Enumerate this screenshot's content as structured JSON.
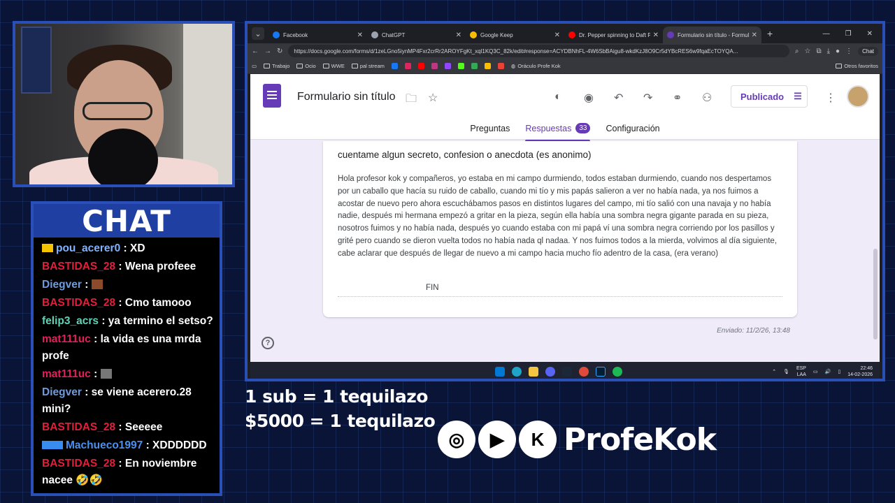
{
  "browser": {
    "tabs": [
      {
        "title": "Facebook",
        "color": "#1877f2"
      },
      {
        "title": "ChatGPT",
        "color": "#9ca3af"
      },
      {
        "title": "Google Keep",
        "color": "#fbbc04"
      },
      {
        "title": "Dr. Pepper spinning to Daft Punk",
        "color": "#ff0000"
      },
      {
        "title": "Formulario sin título - Formulario",
        "color": "#673ab7"
      }
    ],
    "url": "https://docs.google.com/forms/d/1zeLGno5iynMP4Fxr2crRr2AROYFgKt_xql1KQ3C_82k/edit#response=ACYDBNhFL-4W6SbBAigu8-wkdKzJ8O9Cr5dYBcRES6w9fqaEcTOYQA...",
    "chat_label": "Chat",
    "bookmarks": [
      "Trabajo",
      "Ocio",
      "WWE",
      "pal stream"
    ],
    "bookmark_profile": "Oráculo Profe Kok",
    "other_bookmarks": "Otros favoritos"
  },
  "form": {
    "title": "Formulario sin título",
    "publish_label": "Publicado",
    "tabs": [
      "Preguntas",
      "Respuestas",
      "Configuración"
    ],
    "responses_count": "33",
    "question": "cuentame algun secreto, confesion o anecdota (es anonimo)",
    "answer": "Hola profesor kok y compañeros, yo estaba en mi campo durmiendo, todos estaban durmiendo, cuando nos despertamos por un caballo que hacía su ruido de caballo, cuando mi tío y mis papás salieron a ver no había nada, ya nos fuimos a acostar de nuevo pero ahora escuchábamos pasos en distintos lugares del campo, mi tío salió con una navaja y no había nadie, después mi hermana empezó a gritar en la pieza, según ella había una sombra negra gigante parada en su pieza, nosotros fuimos y no había nada, después yo cuando estaba con mi papá ví una sombra negra corriendo por los pasillos y grité pero cuando se dieron vuelta todos no había nada ql nadaa. Y nos fuimos todos a la mierda, volvimos al día siguiente, cabe aclarar que después de llegar de nuevo a mi campo hacia mucho fío adentro de la casa, (era verano)",
    "fin": "FIN",
    "sent": "Enviado: 11/2/26, 13:48"
  },
  "taskbar": {
    "lang": "ESP",
    "region": "LAA",
    "time": "22:46",
    "date": "14-02-2026"
  },
  "chat": {
    "header": "CHAT",
    "messages": [
      {
        "user": "pou_acerer0",
        "color": "#7fb3ff",
        "text": ": XD"
      },
      {
        "user": "BASTIDAS_28",
        "color": "#e0203a",
        "text": ": Wena profeee"
      },
      {
        "user": "Diegver",
        "color": "#6f9bdc",
        "text": ":"
      },
      {
        "user": "BASTIDAS_28",
        "color": "#e0203a",
        "text": ": Cmo tamooo"
      },
      {
        "user": "felip3_acrs",
        "color": "#5fd3b6",
        "text": ": ya termino el setso?"
      },
      {
        "user": "mat111uc",
        "color": "#e0205a",
        "text": ": la vida es una mrda profe"
      },
      {
        "user": "mat111uc",
        "color": "#e0205a",
        "text": ":"
      },
      {
        "user": "Diegver",
        "color": "#6f9bdc",
        "text": ": se viene acerero.28 mini?"
      },
      {
        "user": "BASTIDAS_28",
        "color": "#e0203a",
        "text": ": Seeeee"
      },
      {
        "user": "Machueco1997",
        "color": "#4a90f0",
        "text": ": XDDDDDD"
      },
      {
        "user": "BASTIDAS_28",
        "color": "#e0203a",
        "text": ": En noviembre nacee 🤣🤣"
      }
    ]
  },
  "overlay": {
    "promo1": "1 sub = 1 tequilazo",
    "promo2": "$5000 = 1 tequilazo",
    "brand": "ProfeKok"
  }
}
